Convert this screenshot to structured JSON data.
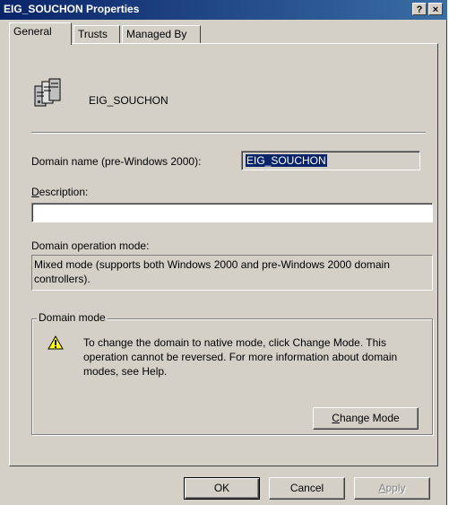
{
  "window": {
    "title": "EIG_SOUCHON Properties",
    "help_button": "?",
    "close_button": "×",
    "title_color": "#0a246a"
  },
  "tabs": [
    {
      "label": "General",
      "active": true
    },
    {
      "label": "Trusts",
      "active": false
    },
    {
      "label": "Managed By",
      "active": false
    }
  ],
  "general": {
    "domain_icon": "domain-servers-icon",
    "domain_name": "EIG_SOUCHON",
    "prewin2000_label": "Domain name (pre-Windows 2000):",
    "prewin2000_value": "EIG_SOUCHON",
    "description_label_rest": "escription:",
    "description_label_accel": "D",
    "description_value": "",
    "operation_mode_label": "Domain operation mode:",
    "operation_mode_text": "Mixed mode (supports both Windows 2000 and pre-Windows 2000 domain controllers).",
    "domain_mode": {
      "legend": "Domain mode",
      "warning_icon": "warning-icon",
      "message": "To change the domain to native mode, click Change Mode. This operation cannot be reversed. For more information about domain modes, see Help.",
      "change_mode_accel": "C",
      "change_mode_rest": "hange Mode"
    }
  },
  "footer": {
    "ok_label": "OK",
    "cancel_label": "Cancel",
    "apply_accel": "A",
    "apply_rest": "pply"
  }
}
